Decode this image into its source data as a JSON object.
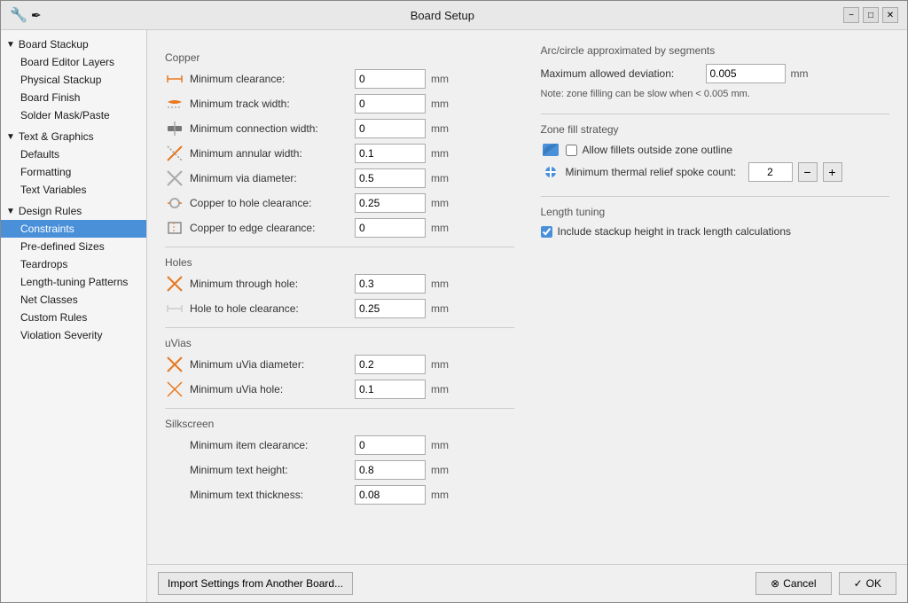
{
  "window": {
    "title": "Board Setup",
    "app_icon": "pcb-icon"
  },
  "sidebar": {
    "groups": [
      {
        "label": "Board Stackup",
        "expanded": true,
        "items": [
          {
            "id": "board-editor-layers",
            "label": "Board Editor Layers"
          },
          {
            "id": "physical-stackup",
            "label": "Physical Stackup"
          },
          {
            "id": "board-finish",
            "label": "Board Finish"
          },
          {
            "id": "solder-mask-paste",
            "label": "Solder Mask/Paste"
          }
        ]
      },
      {
        "label": "Text & Graphics",
        "expanded": true,
        "items": [
          {
            "id": "defaults",
            "label": "Defaults"
          },
          {
            "id": "formatting",
            "label": "Formatting"
          },
          {
            "id": "text-variables",
            "label": "Text Variables"
          }
        ]
      },
      {
        "label": "Design Rules",
        "expanded": true,
        "items": [
          {
            "id": "constraints",
            "label": "Constraints",
            "selected": true
          },
          {
            "id": "pre-defined-sizes",
            "label": "Pre-defined Sizes"
          },
          {
            "id": "teardrops",
            "label": "Teardrops"
          },
          {
            "id": "length-tuning-patterns",
            "label": "Length-tuning Patterns"
          },
          {
            "id": "net-classes",
            "label": "Net Classes"
          },
          {
            "id": "custom-rules",
            "label": "Custom Rules"
          },
          {
            "id": "violation-severity",
            "label": "Violation Severity"
          }
        ]
      }
    ]
  },
  "copper": {
    "section_label": "Copper",
    "fields": [
      {
        "id": "min-clearance",
        "label": "Minimum clearance:",
        "value": "0",
        "unit": "mm"
      },
      {
        "id": "min-track-width",
        "label": "Minimum track width:",
        "value": "0",
        "unit": "mm"
      },
      {
        "id": "min-conn-width",
        "label": "Minimum connection width:",
        "value": "0",
        "unit": "mm"
      },
      {
        "id": "min-annular-width",
        "label": "Minimum annular width:",
        "value": "0.1",
        "unit": "mm"
      },
      {
        "id": "min-via-diameter",
        "label": "Minimum via diameter:",
        "value": "0.5",
        "unit": "mm"
      },
      {
        "id": "cu-hole-clearance",
        "label": "Copper to hole clearance:",
        "value": "0.25",
        "unit": "mm"
      },
      {
        "id": "cu-edge-clearance",
        "label": "Copper to edge clearance:",
        "value": "0",
        "unit": "mm"
      }
    ]
  },
  "holes": {
    "section_label": "Holes",
    "fields": [
      {
        "id": "min-through-hole",
        "label": "Minimum through hole:",
        "value": "0.3",
        "unit": "mm"
      },
      {
        "id": "hole-clearance",
        "label": "Hole to hole clearance:",
        "value": "0.25",
        "unit": "mm"
      }
    ]
  },
  "uvias": {
    "section_label": "uVias",
    "fields": [
      {
        "id": "min-uvia-diameter",
        "label": "Minimum uVia diameter:",
        "value": "0.2",
        "unit": "mm"
      },
      {
        "id": "min-uvia-hole",
        "label": "Minimum uVia hole:",
        "value": "0.1",
        "unit": "mm"
      }
    ]
  },
  "silkscreen": {
    "section_label": "Silkscreen",
    "fields": [
      {
        "id": "min-item-clearance",
        "label": "Minimum item clearance:",
        "value": "0",
        "unit": "mm"
      },
      {
        "id": "min-text-height",
        "label": "Minimum text height:",
        "value": "0.8",
        "unit": "mm"
      },
      {
        "id": "min-text-thickness",
        "label": "Minimum text thickness:",
        "value": "0.08",
        "unit": "mm"
      }
    ]
  },
  "arc_segments": {
    "section_label": "Arc/circle approximated by segments",
    "max_deviation_label": "Maximum allowed deviation:",
    "max_deviation_value": "0.005",
    "max_deviation_unit": "mm",
    "note": "Note: zone filling can be slow when < 0.005 mm."
  },
  "zone_fill": {
    "section_label": "Zone fill strategy",
    "allow_fillets_label": "Allow fillets outside zone outline",
    "allow_fillets_checked": false,
    "thermal_spoke_label": "Minimum thermal relief spoke count:",
    "thermal_spoke_value": "2"
  },
  "length_tuning": {
    "section_label": "Length tuning",
    "stackup_label": "Include stackup height in track length calculations",
    "stackup_checked": true
  },
  "footer": {
    "import_btn": "Import Settings from Another Board...",
    "cancel_btn": "Cancel",
    "ok_btn": "OK",
    "cancel_icon": "⊗",
    "ok_icon": "✓"
  }
}
